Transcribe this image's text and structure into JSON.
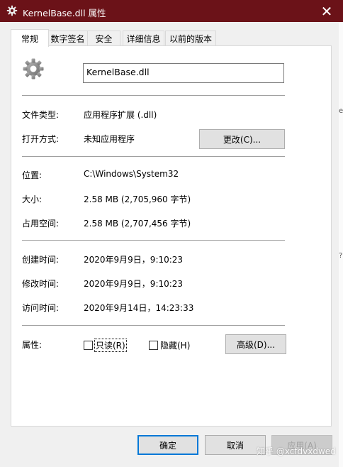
{
  "window": {
    "title": "KernelBase.dll 属性",
    "close_glyph": "✕",
    "title_bar_color": "#6b1218"
  },
  "tabs": [
    {
      "label": "常规",
      "active": true
    },
    {
      "label": "数字签名",
      "active": false
    },
    {
      "label": "安全",
      "active": false
    },
    {
      "label": "详细信息",
      "active": false
    },
    {
      "label": "以前的版本",
      "active": false
    }
  ],
  "general": {
    "file_icon": "gear-file-icon",
    "file_name": "KernelBase.dll",
    "type_label": "文件类型:",
    "type_value": "应用程序扩展 (.dll)",
    "opens_with_label": "打开方式:",
    "opens_with_value": "未知应用程序",
    "change_button": "更改(C)...",
    "location_label": "位置:",
    "location_value": "C:\\Windows\\System32",
    "size_label": "大小:",
    "size_value": "2.58 MB (2,705,960 字节)",
    "size_on_disk_label": "占用空间:",
    "size_on_disk_value": "2.58 MB (2,707,456 字节)",
    "created_label": "创建时间:",
    "created_value": "2020年9月9日，9:10:23",
    "modified_label": "修改时间:",
    "modified_value": "2020年9月9日，9:10:23",
    "accessed_label": "访问时间:",
    "accessed_value": "2020年9月14日，14:23:33",
    "attributes_label": "属性:",
    "readonly_label": "只读(R)",
    "readonly_checked": false,
    "hidden_label": "隐藏(H)",
    "hidden_checked": false,
    "advanced_button": "高级(D)..."
  },
  "footer": {
    "ok_button": "确定",
    "cancel_button": "取消",
    "apply_button": "应用(A)"
  },
  "watermark": "知乎 @xcfdvxdwed",
  "right_edge_fragments": [
    "e",
    "?"
  ]
}
